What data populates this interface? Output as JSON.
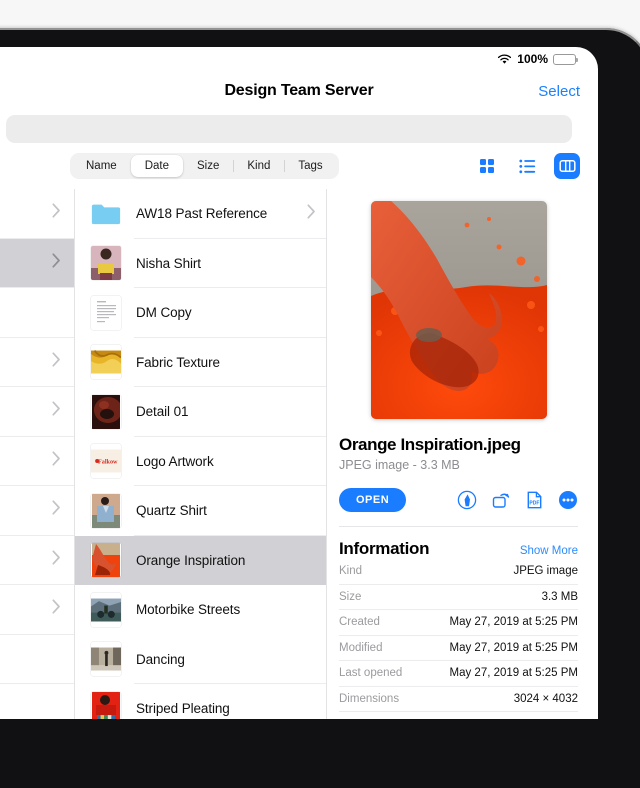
{
  "status_bar": {
    "wifi_icon": "wifi-icon",
    "battery_text": "100%",
    "battery_icon": "battery-icon"
  },
  "nav": {
    "title": "Design Team Server",
    "select_label": "Select"
  },
  "search": {
    "value": "",
    "placeholder": ""
  },
  "toolbar": {
    "segments": [
      {
        "label": "Name",
        "active": false
      },
      {
        "label": "Date",
        "active": true
      },
      {
        "label": "Size",
        "active": false
      },
      {
        "label": "Kind",
        "active": false
      },
      {
        "label": "Tags",
        "active": false
      }
    ],
    "views": [
      {
        "name": "grid-view-icon",
        "active": false
      },
      {
        "name": "list-view-icon",
        "active": false
      },
      {
        "name": "column-view-icon",
        "active": true
      }
    ],
    "accent_color": "#1a7cff"
  },
  "previous_column": {
    "rows": [
      {
        "chevron": true,
        "selected": false
      },
      {
        "chevron": true,
        "selected": true
      },
      {
        "chevron": false,
        "selected": false
      },
      {
        "chevron": true,
        "selected": false
      },
      {
        "chevron": true,
        "selected": false
      },
      {
        "chevron": true,
        "selected": false
      },
      {
        "chevron": true,
        "selected": false
      },
      {
        "chevron": true,
        "selected": false
      },
      {
        "chevron": true,
        "selected": false
      },
      {
        "chevron": false,
        "selected": false
      },
      {
        "chevron": false,
        "selected": false
      }
    ]
  },
  "file_list": {
    "items": [
      {
        "name": "AW18 Past Reference",
        "icon": "folder-icon",
        "chevron": true,
        "selected": false
      },
      {
        "name": "Nisha Shirt",
        "icon": "image-thumb",
        "chevron": false,
        "selected": false
      },
      {
        "name": "DM Copy",
        "icon": "document-thumb",
        "chevron": false,
        "selected": false
      },
      {
        "name": "Fabric Texture",
        "icon": "image-thumb",
        "chevron": false,
        "selected": false
      },
      {
        "name": "Detail 01",
        "icon": "image-thumb",
        "chevron": false,
        "selected": false
      },
      {
        "name": "Logo Artwork",
        "icon": "logo-thumb",
        "chevron": false,
        "selected": false
      },
      {
        "name": "Quartz Shirt",
        "icon": "image-thumb",
        "chevron": false,
        "selected": false
      },
      {
        "name": "Orange Inspiration",
        "icon": "image-thumb",
        "chevron": false,
        "selected": true
      },
      {
        "name": "Motorbike Streets",
        "icon": "image-thumb",
        "chevron": false,
        "selected": false
      },
      {
        "name": "Dancing",
        "icon": "image-thumb",
        "chevron": false,
        "selected": false
      },
      {
        "name": "Striped Pleating",
        "icon": "image-thumb",
        "chevron": false,
        "selected": false
      }
    ]
  },
  "detail": {
    "preview_alt": "hand-in-orange-powder-preview",
    "title": "Orange Inspiration.jpeg",
    "subtitle": "JPEG image - 3.3 MB",
    "open_label": "OPEN",
    "action_icons": [
      {
        "name": "markup-icon"
      },
      {
        "name": "rotate-icon"
      },
      {
        "name": "pdf-icon"
      },
      {
        "name": "more-icon"
      }
    ],
    "information": {
      "heading": "Information",
      "show_more_label": "Show More",
      "rows": [
        {
          "label": "Kind",
          "value": "JPEG image"
        },
        {
          "label": "Size",
          "value": "3.3 MB"
        },
        {
          "label": "Created",
          "value": "May 27, 2019 at 5:25 PM"
        },
        {
          "label": "Modified",
          "value": "May 27, 2019 at 5:25 PM"
        },
        {
          "label": "Last opened",
          "value": "May 27, 2019 at 5:25 PM"
        },
        {
          "label": "Dimensions",
          "value": "3024 × 4032"
        }
      ]
    }
  }
}
